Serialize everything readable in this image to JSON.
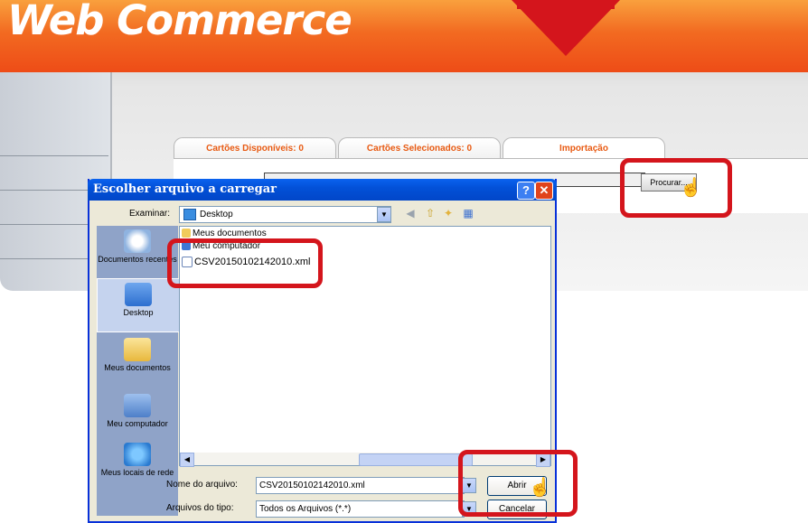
{
  "app": {
    "brand": "Web Commerce",
    "tabs": [
      {
        "label": "Cartões Disponíveis: 0"
      },
      {
        "label": "Cartões Selecionados: 0"
      },
      {
        "label": "Importação"
      }
    ],
    "browse_button": "Procurar..."
  },
  "dialog": {
    "title": "Escolher arquivo a carregar",
    "look_in_label": "Examinar:",
    "look_in_value": "Desktop",
    "toolbar_icons": [
      "back-icon",
      "up-folder-icon",
      "new-folder-icon",
      "view-menu-icon"
    ],
    "places": [
      {
        "label": "Documentos recentes",
        "icon": "recent-documents-icon"
      },
      {
        "label": "Desktop",
        "icon": "desktop-icon",
        "selected": true
      },
      {
        "label": "Meus documentos",
        "icon": "my-documents-icon"
      },
      {
        "label": "Meu computador",
        "icon": "my-computer-icon"
      },
      {
        "label": "Meus locais de rede",
        "icon": "network-places-icon"
      }
    ],
    "files": [
      {
        "name": "Meus documentos",
        "icon": "folder-icon"
      },
      {
        "name": "Meu computador",
        "icon": "computer-icon"
      },
      {
        "name": "CSV20150102142010.xml",
        "icon": "xml-file-icon"
      }
    ],
    "filename_label": "Nome do arquivo:",
    "filename_value": "CSV20150102142010.xml",
    "filetype_label": "Arquivos do tipo:",
    "filetype_value": "Todos os Arquivos (*.*)",
    "open_button": "Abrir",
    "cancel_button": "Cancelar"
  },
  "colors": {
    "banner_orange": "#f26a21",
    "highlight_red": "#d4151c",
    "xp_title_blue": "#0351d8"
  }
}
